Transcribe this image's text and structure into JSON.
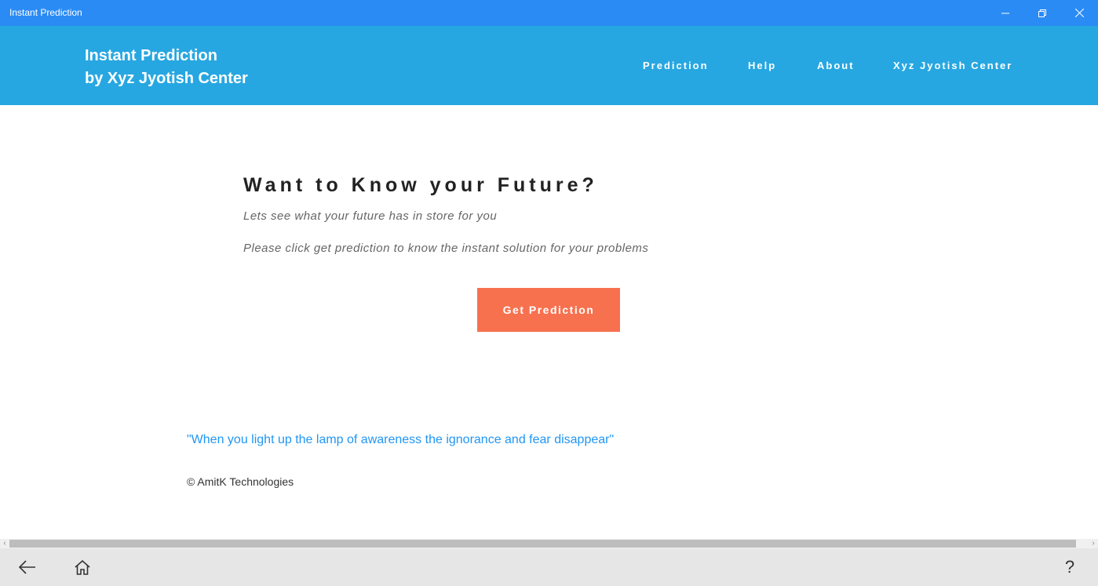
{
  "window": {
    "title": "Instant Prediction",
    "minimize_icon": "minimize-icon",
    "maximize_icon": "restore-icon",
    "close_icon": "close-icon"
  },
  "header": {
    "brand_line1": "Instant Prediction",
    "brand_line2": "by Xyz Jyotish Center",
    "background": "#27a7e1",
    "nav": [
      {
        "label": "Prediction"
      },
      {
        "label": "Help"
      },
      {
        "label": "About"
      },
      {
        "label": "Xyz Jyotish Center"
      }
    ]
  },
  "main": {
    "title": "Want to Know your Future?",
    "subtitle": "Lets see what your future has in store for you",
    "instruction": "Please click get prediction to know the instant solution for your problems",
    "cta_label": "Get Prediction",
    "cta_color": "#f7714f",
    "quote": "\"When you light up the lamp of awareness the ignorance and fear disappear\"",
    "copyright": "© AmitK Technologies"
  },
  "bottombar": {
    "back_icon": "back-arrow-icon",
    "home_icon": "home-icon",
    "help_glyph": "?"
  }
}
